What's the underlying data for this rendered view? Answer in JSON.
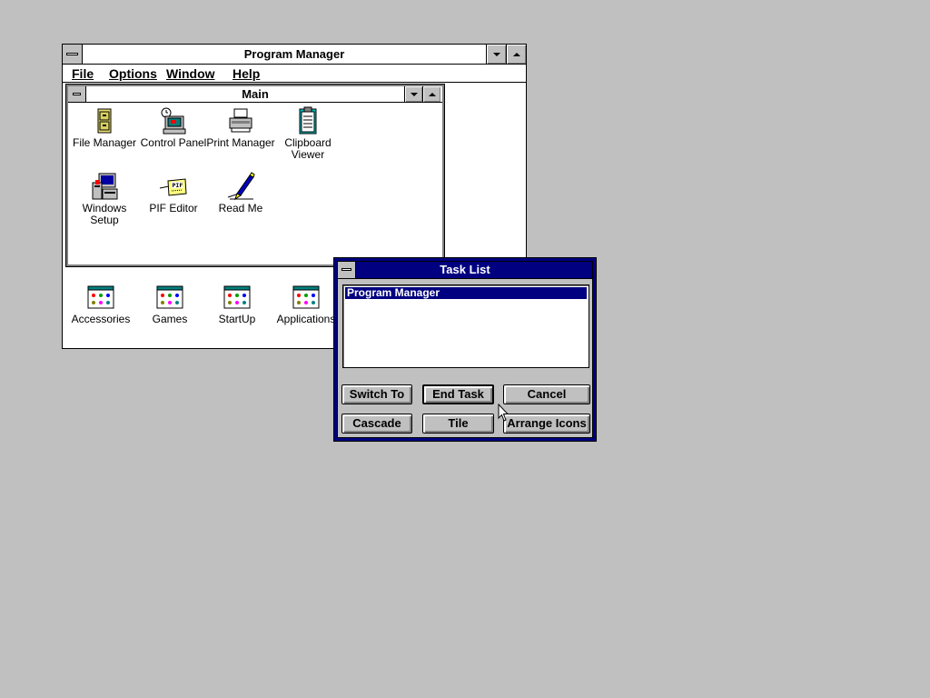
{
  "program_manager": {
    "title": "Program Manager",
    "menu": [
      "File",
      "Options",
      "Window",
      "Help"
    ]
  },
  "main_group": {
    "title": "Main",
    "icons": [
      {
        "label_lines": [
          "File Manager"
        ],
        "icon": "file-manager-icon"
      },
      {
        "label_lines": [
          "Control Panel"
        ],
        "icon": "control-panel-icon"
      },
      {
        "label_lines": [
          "Print Manager"
        ],
        "icon": "print-manager-icon"
      },
      {
        "label_lines": [
          "Clipboard",
          "Viewer"
        ],
        "icon": "clipboard-viewer-icon"
      },
      {
        "label_lines": [
          "Windows",
          "Setup"
        ],
        "icon": "windows-setup-icon"
      },
      {
        "label_lines": [
          "PIF Editor"
        ],
        "icon": "pif-editor-icon"
      },
      {
        "label_lines": [
          "Read Me"
        ],
        "icon": "read-me-icon"
      }
    ]
  },
  "groups": [
    {
      "label": "Accessories",
      "icon": "program-group-icon"
    },
    {
      "label": "Games",
      "icon": "program-group-icon"
    },
    {
      "label": "StartUp",
      "icon": "program-group-icon"
    },
    {
      "label": "Applications",
      "icon": "program-group-icon"
    }
  ],
  "task_list": {
    "title": "Task List",
    "items": [
      "Program Manager"
    ],
    "selected_index": 0,
    "buttons_row1": [
      "Switch To",
      "End Task",
      "Cancel"
    ],
    "buttons_row2": [
      "Cascade",
      "Tile",
      "Arrange Icons"
    ],
    "default_button": "End Task"
  },
  "colors": {
    "desktop": "#c0c0c0",
    "active_title": "#000080",
    "window": "#ffffff"
  }
}
